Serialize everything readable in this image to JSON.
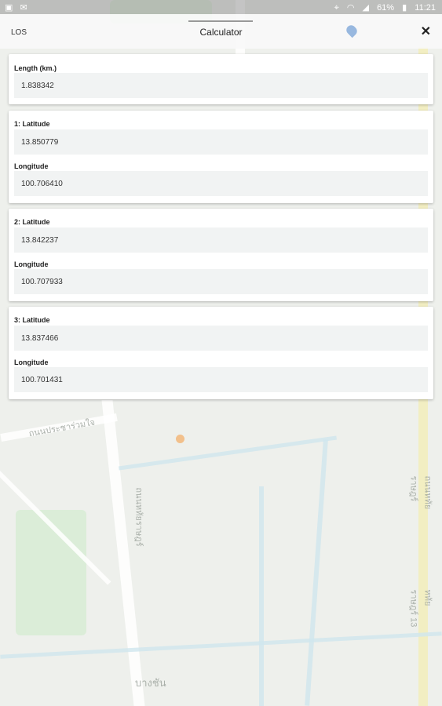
{
  "status_bar": {
    "time": "11:21",
    "battery": "61%",
    "left_icons": [
      "photo-icon",
      "mail-icon"
    ],
    "right_icons": [
      "location-icon",
      "wifi-icon",
      "signal-icon",
      "battery-icon"
    ]
  },
  "header": {
    "app_label": "LOS",
    "title": "Calculator",
    "close_glyph": "✕"
  },
  "cards": [
    {
      "fields": [
        {
          "label": "Length (km.)",
          "value": "1.838342"
        }
      ]
    },
    {
      "fields": [
        {
          "label": "1: Latitude",
          "value": "13.850779"
        },
        {
          "label": "Longitude",
          "value": "100.706410"
        }
      ]
    },
    {
      "fields": [
        {
          "label": "2: Latitude",
          "value": "13.842237"
        },
        {
          "label": "Longitude",
          "value": "100.707933"
        }
      ]
    },
    {
      "fields": [
        {
          "label": "3: Latitude",
          "value": "13.837466"
        },
        {
          "label": "Longitude",
          "value": "100.701431"
        }
      ]
    }
  ],
  "map_labels": [
    "ถนนประชาร่วมใจ",
    "ถนนหทัยราษฎร์",
    "บางชัน",
    "หทัยราษฎร์ 13",
    "ถนนหทัยราษฎร์"
  ]
}
